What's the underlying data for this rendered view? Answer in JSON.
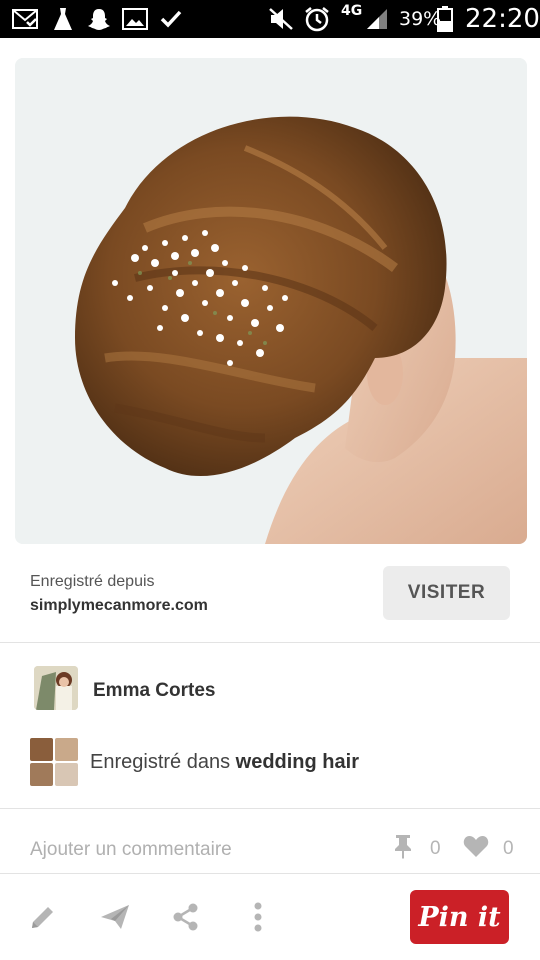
{
  "status_bar": {
    "network": "4G",
    "battery_percent": "39%",
    "time": "22:20",
    "icons": [
      "mail-icon",
      "dress-icon",
      "snapchat-icon",
      "image-icon",
      "check-icon",
      "mute-icon",
      "alarm-icon",
      "signal-icon",
      "battery-icon"
    ]
  },
  "pin": {
    "image_desc_icon": "photo",
    "saved_from_label": "Enregistré depuis",
    "saved_from_domain": "simplymecanmore.com",
    "visit_label": "VISITER"
  },
  "user": {
    "name": "Emma Cortes"
  },
  "board": {
    "prefix": "Enregistré dans ",
    "name": "wedding hair"
  },
  "comment": {
    "placeholder": "Ajouter un commentaire"
  },
  "stats": {
    "repins": "0",
    "likes": "0"
  },
  "toolbar": {
    "pin_it_label": "Pin it"
  },
  "colors": {
    "pinit_red": "#cb2027",
    "visit_bg": "#ececec",
    "muted_gray": "#b5b5b5"
  }
}
